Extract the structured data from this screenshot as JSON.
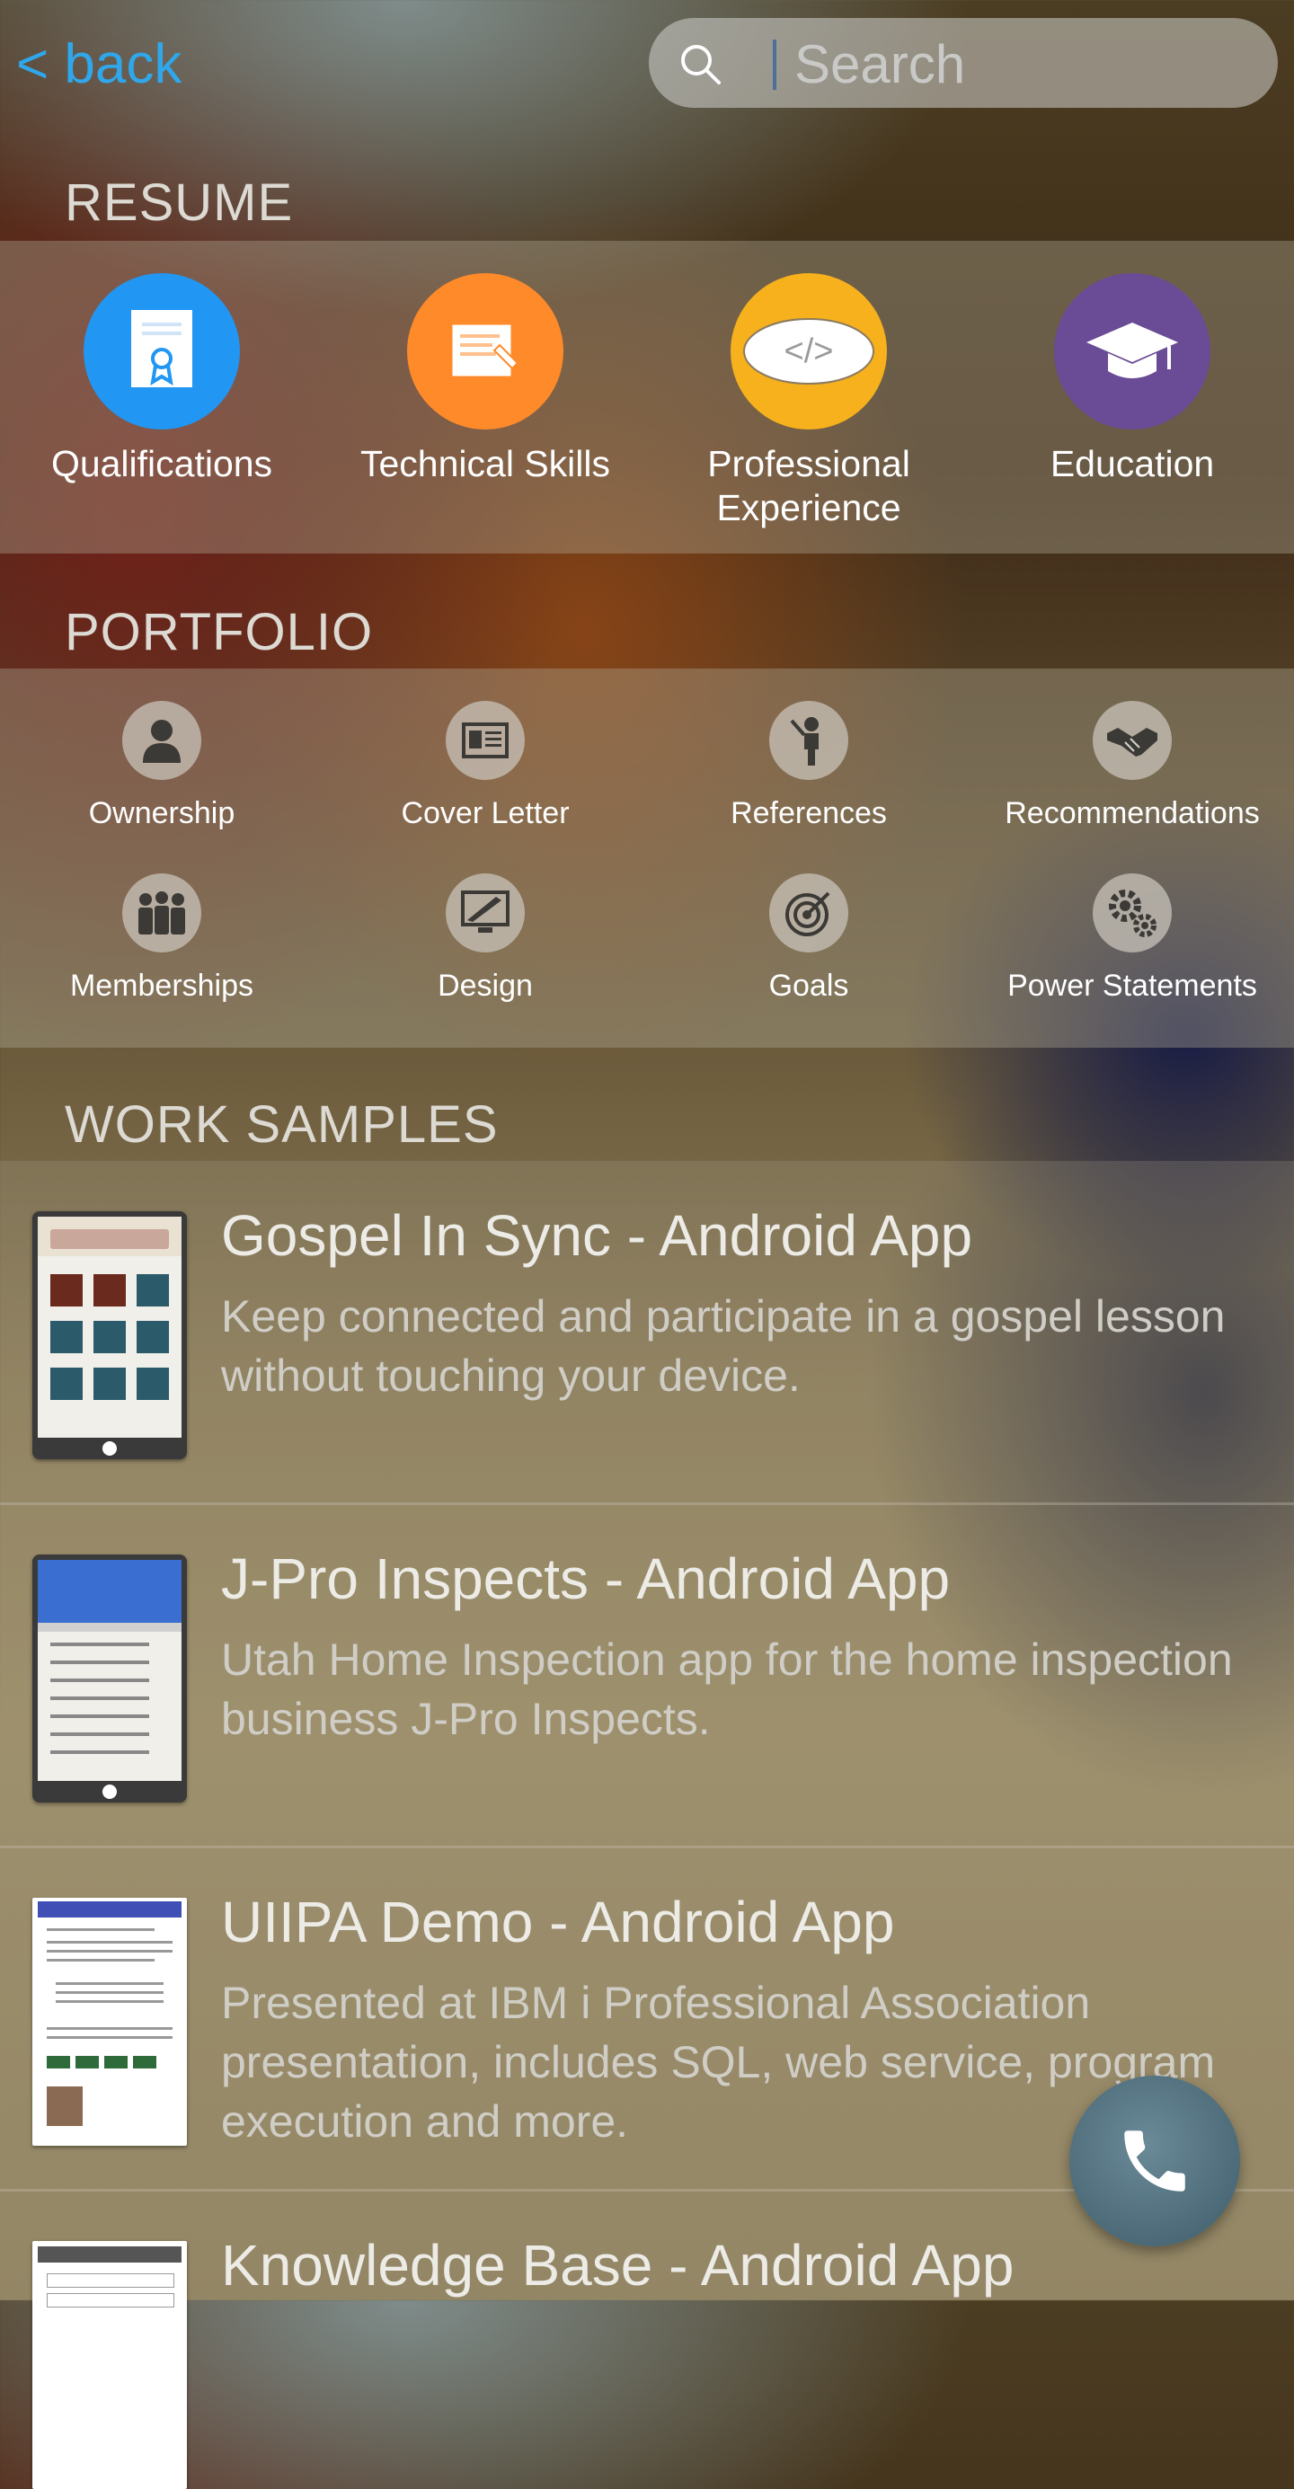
{
  "header": {
    "back_label": "< back",
    "search_placeholder": "Search"
  },
  "resume": {
    "title": "RESUME",
    "items": [
      {
        "label": "Qualifications",
        "icon": "certificate-icon",
        "color": "#2196f3"
      },
      {
        "label": "Technical Skills",
        "icon": "document-edit-icon",
        "color": "#ff8a2a"
      },
      {
        "label": "Professional Experience",
        "icon": "code-icon",
        "color": "#f6b11c"
      },
      {
        "label": "Education",
        "icon": "graduation-cap-icon",
        "color": "#6a4b95"
      }
    ]
  },
  "portfolio": {
    "title": "PORTFOLIO",
    "items": [
      {
        "label": "Ownership",
        "icon": "person-icon"
      },
      {
        "label": "Cover Letter",
        "icon": "id-card-icon"
      },
      {
        "label": "References",
        "icon": "presenter-icon"
      },
      {
        "label": "Recommendations",
        "icon": "handshake-icon"
      },
      {
        "label": "Memberships",
        "icon": "group-icon"
      },
      {
        "label": "Design",
        "icon": "design-monitor-icon"
      },
      {
        "label": "Goals",
        "icon": "target-icon"
      },
      {
        "label": "Power Statements",
        "icon": "gears-icon"
      }
    ]
  },
  "work_samples": {
    "title": "WORK SAMPLES",
    "items": [
      {
        "title": "Gospel In Sync - Android App",
        "description": "Keep connected and participate in a gospel lesson without touching your device."
      },
      {
        "title": "J-Pro Inspects - Android App",
        "description": "Utah Home Inspection app for the home inspection business J-Pro Inspects."
      },
      {
        "title": "UIIPA Demo - Android App",
        "description": "Presented at IBM i Professional Association presentation, includes SQL, web service, program execution and more."
      },
      {
        "title": "Knowledge Base - Android App",
        "description": ""
      }
    ]
  },
  "fab": {
    "icon": "phone-icon"
  }
}
